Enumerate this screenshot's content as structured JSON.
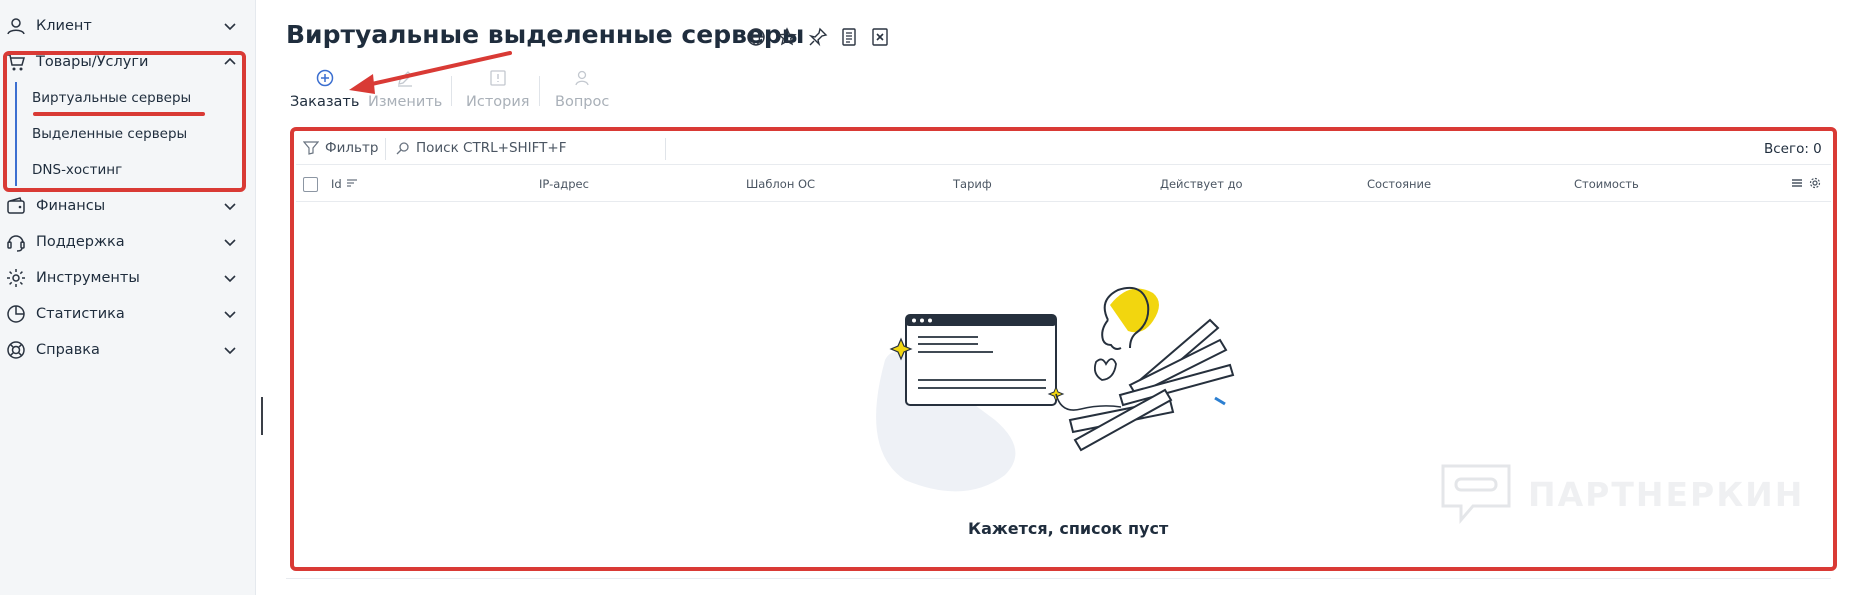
{
  "sidebar": {
    "items": [
      {
        "label": "Клиент",
        "icon": "user-icon"
      },
      {
        "label": "Товары/Услуги",
        "icon": "cart-icon"
      },
      {
        "label": "Финансы",
        "icon": "wallet-icon"
      },
      {
        "label": "Поддержка",
        "icon": "headset-icon"
      },
      {
        "label": "Инструменты",
        "icon": "gear-icon"
      },
      {
        "label": "Статистика",
        "icon": "pie-chart-icon"
      },
      {
        "label": "Справка",
        "icon": "lifebuoy-icon"
      }
    ],
    "submenu": [
      {
        "label": "Виртуальные серверы",
        "active": true
      },
      {
        "label": "Выделенные серверы",
        "active": false
      },
      {
        "label": "DNS-хостинг",
        "active": false
      }
    ]
  },
  "page": {
    "title": "Виртуальные выделенные серверы",
    "title_icons": [
      "globe-icon",
      "star-icon",
      "pin-icon",
      "document-icon",
      "excel-icon"
    ]
  },
  "toolbar": {
    "order_label": "Заказать",
    "edit_label": "Изменить",
    "history_label": "История",
    "question_label": "Вопрос"
  },
  "filter": {
    "filter_label": "Фильтр",
    "search_placeholder": "Поиск CTRL+SHIFT+F",
    "total_label": "Всего: 0"
  },
  "table": {
    "columns": [
      "Id",
      "IP-адрес",
      "Шаблон ОС",
      "Тариф",
      "Действует до",
      "Состояние",
      "Стоимость"
    ]
  },
  "empty_state": {
    "message": "Кажется, список пуст"
  },
  "watermark": {
    "text": "ПАРТНЕРКИН"
  },
  "colors": {
    "accent": "#3c6fd0",
    "highlight_red": "#d93a35",
    "illustration_yellow": "#f2d60f",
    "sidebar_bg": "#f4f6f8"
  }
}
